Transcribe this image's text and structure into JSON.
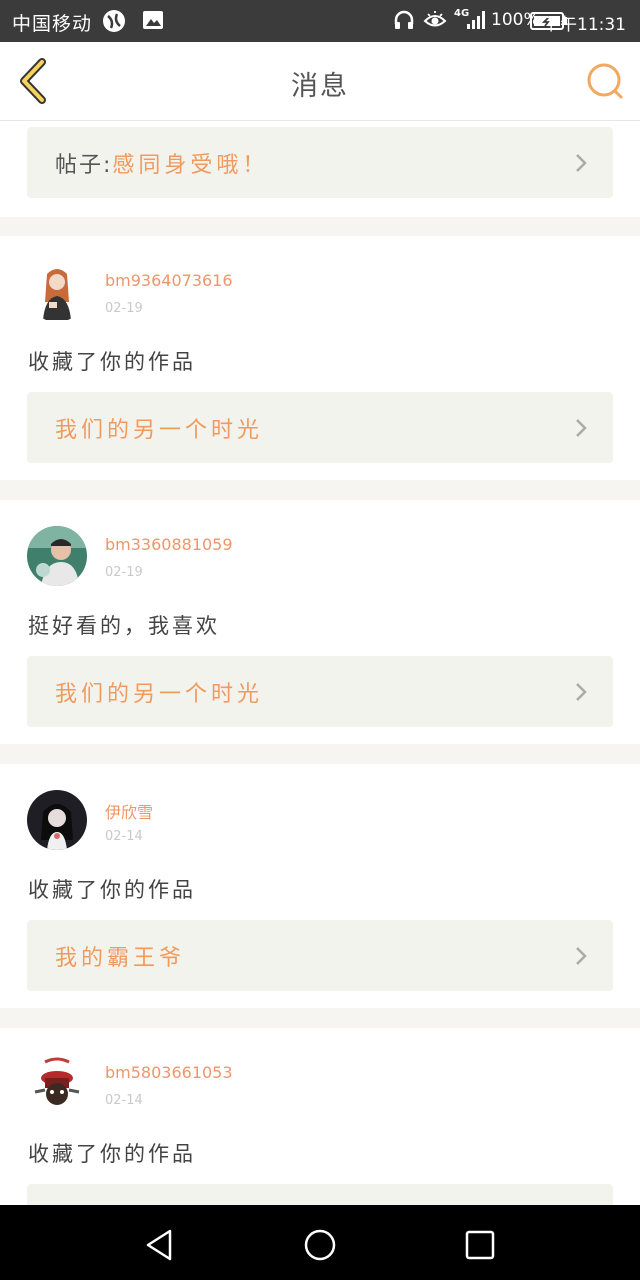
{
  "status_bar": {
    "carrier": "中国移动",
    "network": "4G",
    "battery": "100%",
    "time": "下午11:31"
  },
  "header": {
    "title": "消息"
  },
  "colors": {
    "accent": "#f0956a",
    "card_bg": "#f3f3ee",
    "header_icon": "#f3a85f"
  },
  "top_card": {
    "prefix": "帖子:",
    "text": "感同身受哦！"
  },
  "items": [
    {
      "username": "bm9364073616",
      "date": "02-19",
      "message": "收藏了你的作品",
      "card_text": "我们的另一个时光"
    },
    {
      "username": "bm3360881059",
      "date": "02-19",
      "message": "挺好看的，我喜欢",
      "card_text": "我们的另一个时光"
    },
    {
      "username": "伊欣雪",
      "date": "02-14",
      "message": "收藏了你的作品",
      "card_text": "我的霸王爷"
    },
    {
      "username": "bm5803661053",
      "date": "02-14",
      "message": "收藏了你的作品",
      "card_text": ""
    }
  ]
}
